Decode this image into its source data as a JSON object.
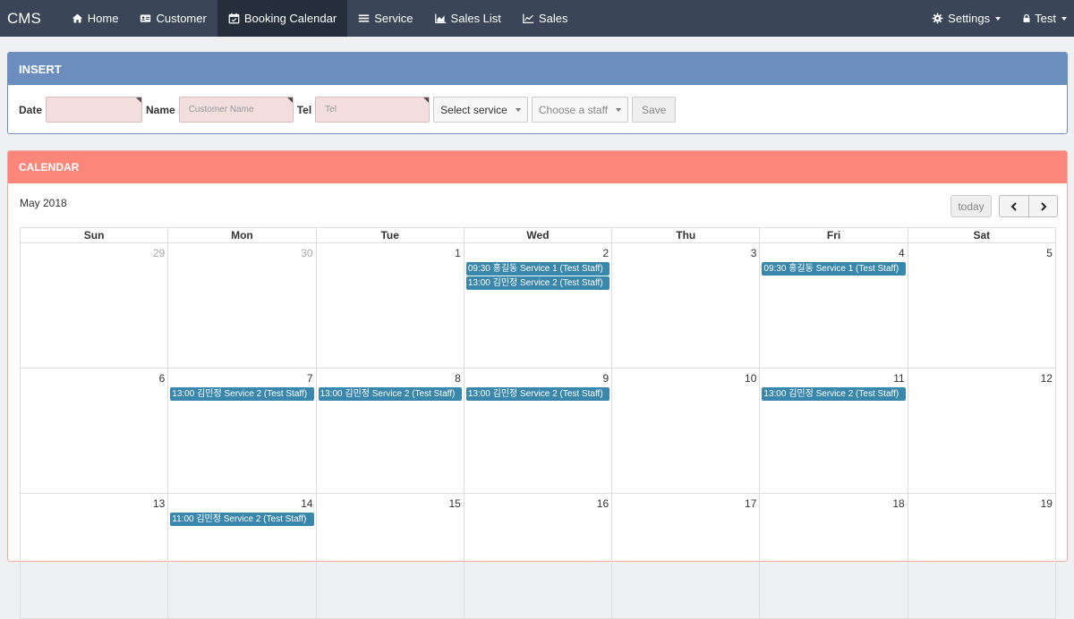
{
  "navbar": {
    "brand": "CMS",
    "items": [
      {
        "label": "Home",
        "icon": "home-icon"
      },
      {
        "label": "Customer",
        "icon": "id-card-icon"
      },
      {
        "label": "Booking Calendar",
        "icon": "calendar-icon",
        "active": true
      },
      {
        "label": "Service",
        "icon": "list-icon"
      },
      {
        "label": "Sales List",
        "icon": "area-chart-icon"
      },
      {
        "label": "Sales",
        "icon": "line-chart-icon"
      }
    ],
    "settings_label": "Settings",
    "user_label": "Test"
  },
  "insert": {
    "title": "INSERT",
    "date_label": "Date",
    "name_label": "Name",
    "name_placeholder": "Customer Name",
    "tel_label": "Tel",
    "tel_placeholder": "Tel",
    "service_select": "Select service",
    "staff_select": "Choose a staff",
    "save_label": "Save"
  },
  "calendar": {
    "panel_title": "CALENDAR",
    "month_title": "May 2018",
    "today_label": "today",
    "days_of_week": [
      "Sun",
      "Mon",
      "Tue",
      "Wed",
      "Thu",
      "Fri",
      "Sat"
    ],
    "weeks": [
      [
        {
          "num": "29",
          "other": true,
          "events": []
        },
        {
          "num": "30",
          "other": true,
          "events": []
        },
        {
          "num": "1",
          "events": []
        },
        {
          "num": "2",
          "events": [
            "09:30 홍길동 Service 1 (Test Staff)",
            "13:00 김민정 Service 2 (Test Staff)"
          ]
        },
        {
          "num": "3",
          "events": []
        },
        {
          "num": "4",
          "events": [
            "09:30 홍길동 Service 1 (Test Staff)"
          ]
        },
        {
          "num": "5",
          "events": []
        }
      ],
      [
        {
          "num": "6",
          "events": []
        },
        {
          "num": "7",
          "events": [
            "13:00 김민정 Service 2 (Test Staff)"
          ]
        },
        {
          "num": "8",
          "events": [
            "13:00 김민정 Service 2 (Test Staff)"
          ]
        },
        {
          "num": "9",
          "events": [
            "13:00 김민정 Service 2 (Test Staff)"
          ]
        },
        {
          "num": "10",
          "events": []
        },
        {
          "num": "11",
          "events": [
            "13:00 김민정 Service 2 (Test Staff)"
          ]
        },
        {
          "num": "12",
          "events": []
        }
      ],
      [
        {
          "num": "13",
          "events": []
        },
        {
          "num": "14",
          "events": [
            "11:00 김민정 Service 2 (Test Staff)"
          ]
        },
        {
          "num": "15",
          "events": []
        },
        {
          "num": "16",
          "events": []
        },
        {
          "num": "17",
          "events": []
        },
        {
          "num": "18",
          "events": []
        },
        {
          "num": "19",
          "events": []
        }
      ]
    ]
  },
  "colors": {
    "navbar": "#3a4657",
    "insert_header": "#6b8ebf",
    "calendar_header": "#fa877a",
    "event": "#3a87ad"
  }
}
